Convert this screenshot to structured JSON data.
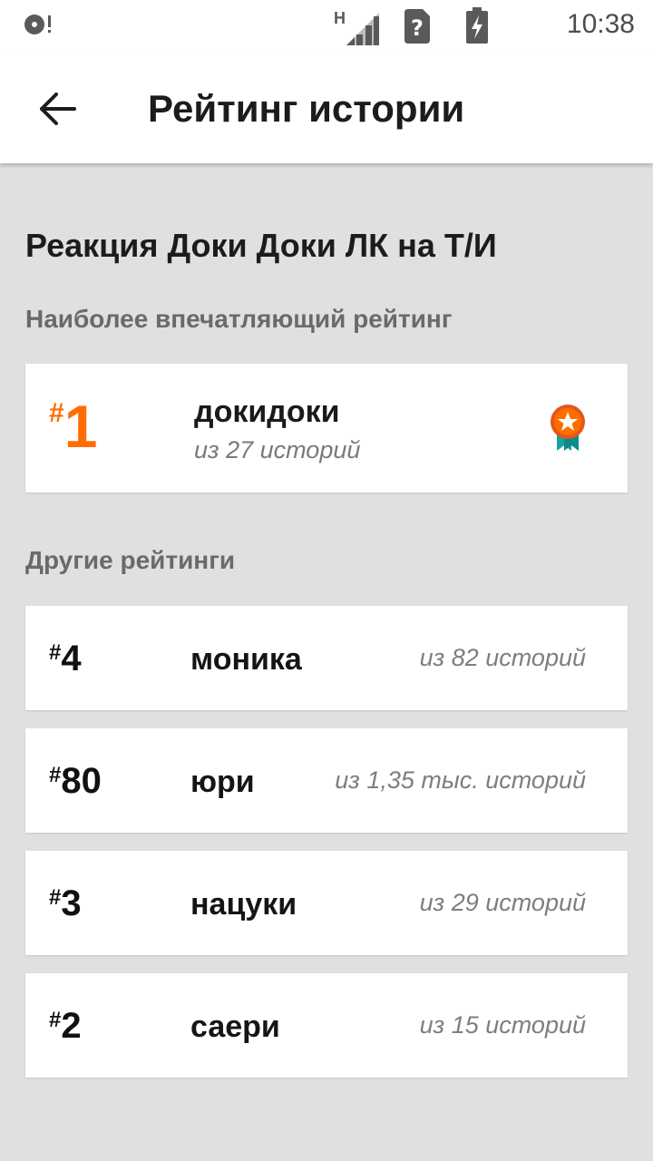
{
  "status_bar": {
    "network_type": "H",
    "time": "10:38",
    "icons": [
      "storage-alert-icon",
      "signal-icon",
      "unknown-sim-icon",
      "battery-charging-icon"
    ]
  },
  "app_bar": {
    "title": "Рейтинг истории",
    "back_icon": "arrow-back-icon"
  },
  "story": {
    "title": "Реакция Доки Доки ЛК на Т/И"
  },
  "top_ranking": {
    "section_label": "Наиболее впечатляющий рейтинг",
    "hash": "#",
    "rank": "1",
    "tag": "докидоки",
    "count": "из 27 историй",
    "accent_color": "#ff6d00",
    "badge_icon": "medal-star-icon"
  },
  "other_rankings": {
    "section_label": "Другие рейтинги",
    "items": [
      {
        "hash": "#",
        "rank": "4",
        "tag": "моника",
        "count": "из 82 историй"
      },
      {
        "hash": "#",
        "rank": "80",
        "tag": "юри",
        "count": "из 1,35 тыс. историй"
      },
      {
        "hash": "#",
        "rank": "3",
        "tag": "нацуки",
        "count": "из 29 историй"
      },
      {
        "hash": "#",
        "rank": "2",
        "tag": "саери",
        "count": "из 15 историй"
      }
    ]
  }
}
